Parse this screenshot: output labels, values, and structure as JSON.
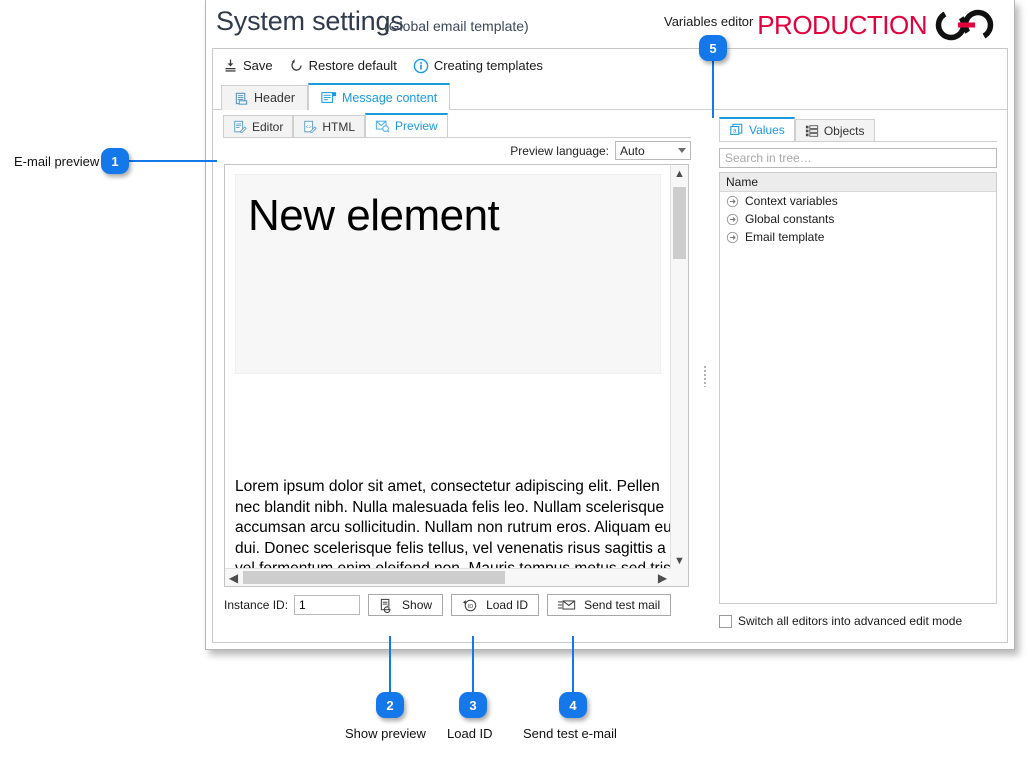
{
  "window": {
    "title": "System settings",
    "subtitle": "(Global email template)",
    "variables_editor_label": "Variables editor",
    "brand": "PRODUCTION",
    "brand_color": "#e3003c",
    "accent_color": "#1b9ae0",
    "callout_color": "#1477ea"
  },
  "command_bar": {
    "items": [
      {
        "label": "Save",
        "icon": "save-icon"
      },
      {
        "label": "Restore default",
        "icon": "restore-icon"
      },
      {
        "label": "Creating templates",
        "icon": "info-icon"
      }
    ]
  },
  "outer_tabs": [
    {
      "label": "Header",
      "icon": "header-icon",
      "active": false
    },
    {
      "label": "Message content",
      "icon": "message-icon",
      "active": true
    }
  ],
  "inner_tabs": [
    {
      "label": "Editor",
      "icon": "editor-icon",
      "active": false
    },
    {
      "label": "HTML",
      "icon": "html-icon",
      "active": false
    },
    {
      "label": "Preview",
      "icon": "preview-icon",
      "active": true
    }
  ],
  "preview_language": {
    "label": "Preview language:",
    "value": "Auto"
  },
  "preview_content": {
    "heading": "New element",
    "body": "Lorem ipsum dolor sit amet, consectetur adipiscing elit. Pellen\nnec blandit nibh. Nulla malesuada felis leo. Nullam scelerisque\naccumsan arcu sollicitudin. Nullam non rutrum eros. Aliquam eu\ndui. Donec scelerisque felis tellus, vel venenatis risus sagittis a\nvel fermentum enim eleifend non. Mauris tempus metus sed tris"
  },
  "bottom_toolbar": {
    "instance_label": "Instance ID:",
    "instance_value": "1",
    "buttons": [
      {
        "label": "Show",
        "icon": "show-document-icon"
      },
      {
        "label": "Load ID",
        "icon": "load-id-icon"
      },
      {
        "label": "Send test mail",
        "icon": "send-mail-icon"
      }
    ]
  },
  "variables_panel": {
    "tabs": [
      {
        "label": "Values",
        "icon": "values-icon",
        "active": true
      },
      {
        "label": "Objects",
        "icon": "objects-icon",
        "active": false
      }
    ],
    "search_placeholder": "Search in tree…",
    "tree_header": "Name",
    "tree_items": [
      {
        "label": "Context variables",
        "icon": "expand-arrow-icon"
      },
      {
        "label": "Global constants",
        "icon": "expand-arrow-icon"
      },
      {
        "label": "Email template",
        "icon": "expand-arrow-icon"
      }
    ],
    "advanced_mode_label": "Switch all editors into advanced edit mode",
    "advanced_mode_checked": false
  },
  "callouts": [
    {
      "number": "1",
      "label": "E-mail preview"
    },
    {
      "number": "2",
      "label": "Show preview"
    },
    {
      "number": "3",
      "label": "Load ID"
    },
    {
      "number": "4",
      "label": "Send test e-mail"
    },
    {
      "number": "5",
      "label": ""
    }
  ]
}
